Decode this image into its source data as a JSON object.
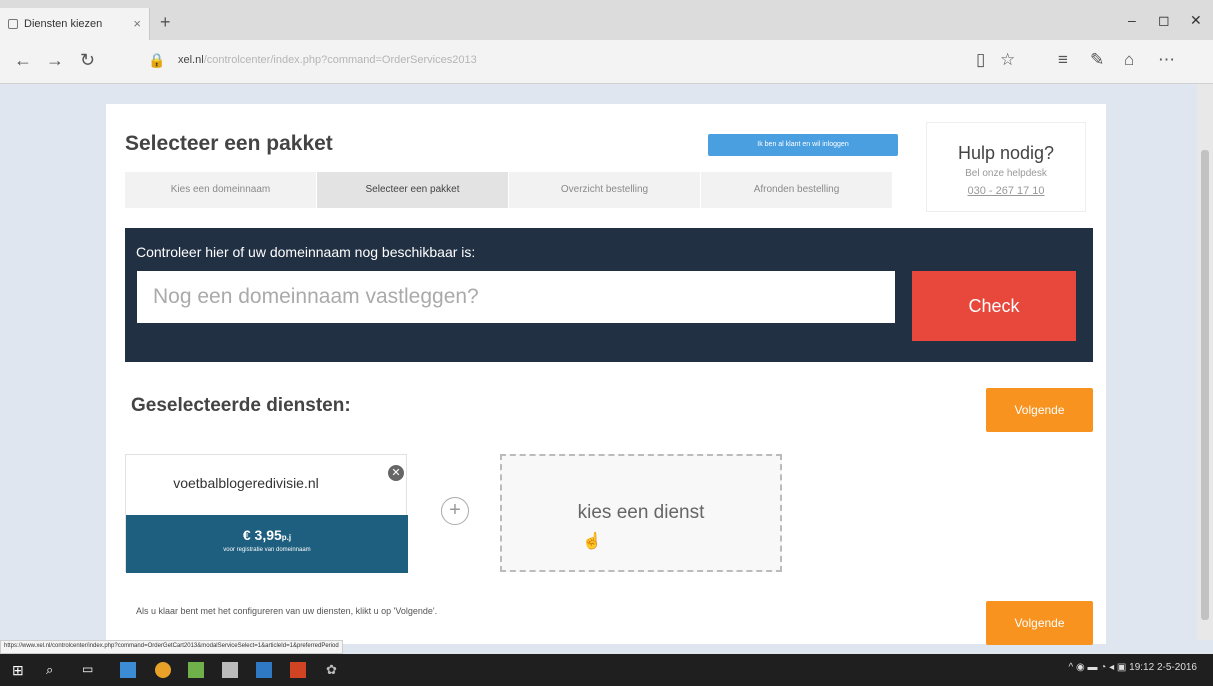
{
  "browser": {
    "tab_title": "Diensten kiezen",
    "new_tab": "+",
    "tab_close": "×",
    "url_domain": "xel.nl",
    "url_path": "/controlcenter/index.php?command=OrderServices2013",
    "status_url": "https://www.xel.nl/controlcenter/index.php?command=OrderGetCart2013&modalServiceSelect=1&articleId=1&preferredPeriod"
  },
  "page": {
    "title": "Selecteer een pakket",
    "login_button": "Ik ben al klant en wil inloggen",
    "help": {
      "title": "Hulp nodig?",
      "subtitle": "Bel onze helpdesk",
      "phone": "030 - 267 17 10"
    },
    "steps": [
      {
        "label": "Kies een domeinnaam",
        "active": false
      },
      {
        "label": "Selecteer een pakket",
        "active": true
      },
      {
        "label": "Overzicht bestelling",
        "active": false
      },
      {
        "label": "Afronden bestelling",
        "active": false
      }
    ],
    "domain_check": {
      "label": "Controleer hier of uw domeinnaam nog beschikbaar is:",
      "placeholder": "Nog een domeinnaam vastleggen?",
      "button": "Check"
    },
    "selected_title": "Geselecteerde diensten:",
    "next_button": "Volgende",
    "service": {
      "domain": "voetbalblogeredivisie.nl",
      "price": "€ 3,95",
      "period": "p.j",
      "price_note": "voor registratie van domeinnaam"
    },
    "choose_service": "kies een dienst",
    "hint": "Als u klaar bent met het configureren van uw diensten, klikt u op 'Volgende'."
  },
  "taskbar": {
    "time": "19:12",
    "date": "2-5-2016"
  },
  "colors": {
    "panel": "#223043",
    "check": "#e8473c",
    "next": "#f7931e",
    "price": "#1e5e7e"
  }
}
